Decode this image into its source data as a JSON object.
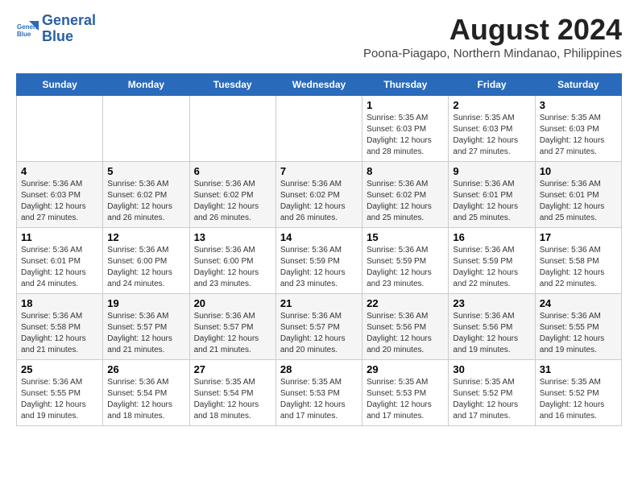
{
  "header": {
    "logo_line1": "General",
    "logo_line2": "Blue",
    "month_year": "August 2024",
    "location": "Poona-Piagapo, Northern Mindanao, Philippines"
  },
  "calendar": {
    "days_of_week": [
      "Sunday",
      "Monday",
      "Tuesday",
      "Wednesday",
      "Thursday",
      "Friday",
      "Saturday"
    ],
    "weeks": [
      [
        {
          "day": "",
          "info": ""
        },
        {
          "day": "",
          "info": ""
        },
        {
          "day": "",
          "info": ""
        },
        {
          "day": "",
          "info": ""
        },
        {
          "day": "1",
          "info": "Sunrise: 5:35 AM\nSunset: 6:03 PM\nDaylight: 12 hours and 28 minutes."
        },
        {
          "day": "2",
          "info": "Sunrise: 5:35 AM\nSunset: 6:03 PM\nDaylight: 12 hours and 27 minutes."
        },
        {
          "day": "3",
          "info": "Sunrise: 5:35 AM\nSunset: 6:03 PM\nDaylight: 12 hours and 27 minutes."
        }
      ],
      [
        {
          "day": "4",
          "info": "Sunrise: 5:36 AM\nSunset: 6:03 PM\nDaylight: 12 hours and 27 minutes."
        },
        {
          "day": "5",
          "info": "Sunrise: 5:36 AM\nSunset: 6:02 PM\nDaylight: 12 hours and 26 minutes."
        },
        {
          "day": "6",
          "info": "Sunrise: 5:36 AM\nSunset: 6:02 PM\nDaylight: 12 hours and 26 minutes."
        },
        {
          "day": "7",
          "info": "Sunrise: 5:36 AM\nSunset: 6:02 PM\nDaylight: 12 hours and 26 minutes."
        },
        {
          "day": "8",
          "info": "Sunrise: 5:36 AM\nSunset: 6:02 PM\nDaylight: 12 hours and 25 minutes."
        },
        {
          "day": "9",
          "info": "Sunrise: 5:36 AM\nSunset: 6:01 PM\nDaylight: 12 hours and 25 minutes."
        },
        {
          "day": "10",
          "info": "Sunrise: 5:36 AM\nSunset: 6:01 PM\nDaylight: 12 hours and 25 minutes."
        }
      ],
      [
        {
          "day": "11",
          "info": "Sunrise: 5:36 AM\nSunset: 6:01 PM\nDaylight: 12 hours and 24 minutes."
        },
        {
          "day": "12",
          "info": "Sunrise: 5:36 AM\nSunset: 6:00 PM\nDaylight: 12 hours and 24 minutes."
        },
        {
          "day": "13",
          "info": "Sunrise: 5:36 AM\nSunset: 6:00 PM\nDaylight: 12 hours and 23 minutes."
        },
        {
          "day": "14",
          "info": "Sunrise: 5:36 AM\nSunset: 5:59 PM\nDaylight: 12 hours and 23 minutes."
        },
        {
          "day": "15",
          "info": "Sunrise: 5:36 AM\nSunset: 5:59 PM\nDaylight: 12 hours and 23 minutes."
        },
        {
          "day": "16",
          "info": "Sunrise: 5:36 AM\nSunset: 5:59 PM\nDaylight: 12 hours and 22 minutes."
        },
        {
          "day": "17",
          "info": "Sunrise: 5:36 AM\nSunset: 5:58 PM\nDaylight: 12 hours and 22 minutes."
        }
      ],
      [
        {
          "day": "18",
          "info": "Sunrise: 5:36 AM\nSunset: 5:58 PM\nDaylight: 12 hours and 21 minutes."
        },
        {
          "day": "19",
          "info": "Sunrise: 5:36 AM\nSunset: 5:57 PM\nDaylight: 12 hours and 21 minutes."
        },
        {
          "day": "20",
          "info": "Sunrise: 5:36 AM\nSunset: 5:57 PM\nDaylight: 12 hours and 21 minutes."
        },
        {
          "day": "21",
          "info": "Sunrise: 5:36 AM\nSunset: 5:57 PM\nDaylight: 12 hours and 20 minutes."
        },
        {
          "day": "22",
          "info": "Sunrise: 5:36 AM\nSunset: 5:56 PM\nDaylight: 12 hours and 20 minutes."
        },
        {
          "day": "23",
          "info": "Sunrise: 5:36 AM\nSunset: 5:56 PM\nDaylight: 12 hours and 19 minutes."
        },
        {
          "day": "24",
          "info": "Sunrise: 5:36 AM\nSunset: 5:55 PM\nDaylight: 12 hours and 19 minutes."
        }
      ],
      [
        {
          "day": "25",
          "info": "Sunrise: 5:36 AM\nSunset: 5:55 PM\nDaylight: 12 hours and 19 minutes."
        },
        {
          "day": "26",
          "info": "Sunrise: 5:36 AM\nSunset: 5:54 PM\nDaylight: 12 hours and 18 minutes."
        },
        {
          "day": "27",
          "info": "Sunrise: 5:35 AM\nSunset: 5:54 PM\nDaylight: 12 hours and 18 minutes."
        },
        {
          "day": "28",
          "info": "Sunrise: 5:35 AM\nSunset: 5:53 PM\nDaylight: 12 hours and 17 minutes."
        },
        {
          "day": "29",
          "info": "Sunrise: 5:35 AM\nSunset: 5:53 PM\nDaylight: 12 hours and 17 minutes."
        },
        {
          "day": "30",
          "info": "Sunrise: 5:35 AM\nSunset: 5:52 PM\nDaylight: 12 hours and 17 minutes."
        },
        {
          "day": "31",
          "info": "Sunrise: 5:35 AM\nSunset: 5:52 PM\nDaylight: 12 hours and 16 minutes."
        }
      ]
    ]
  }
}
